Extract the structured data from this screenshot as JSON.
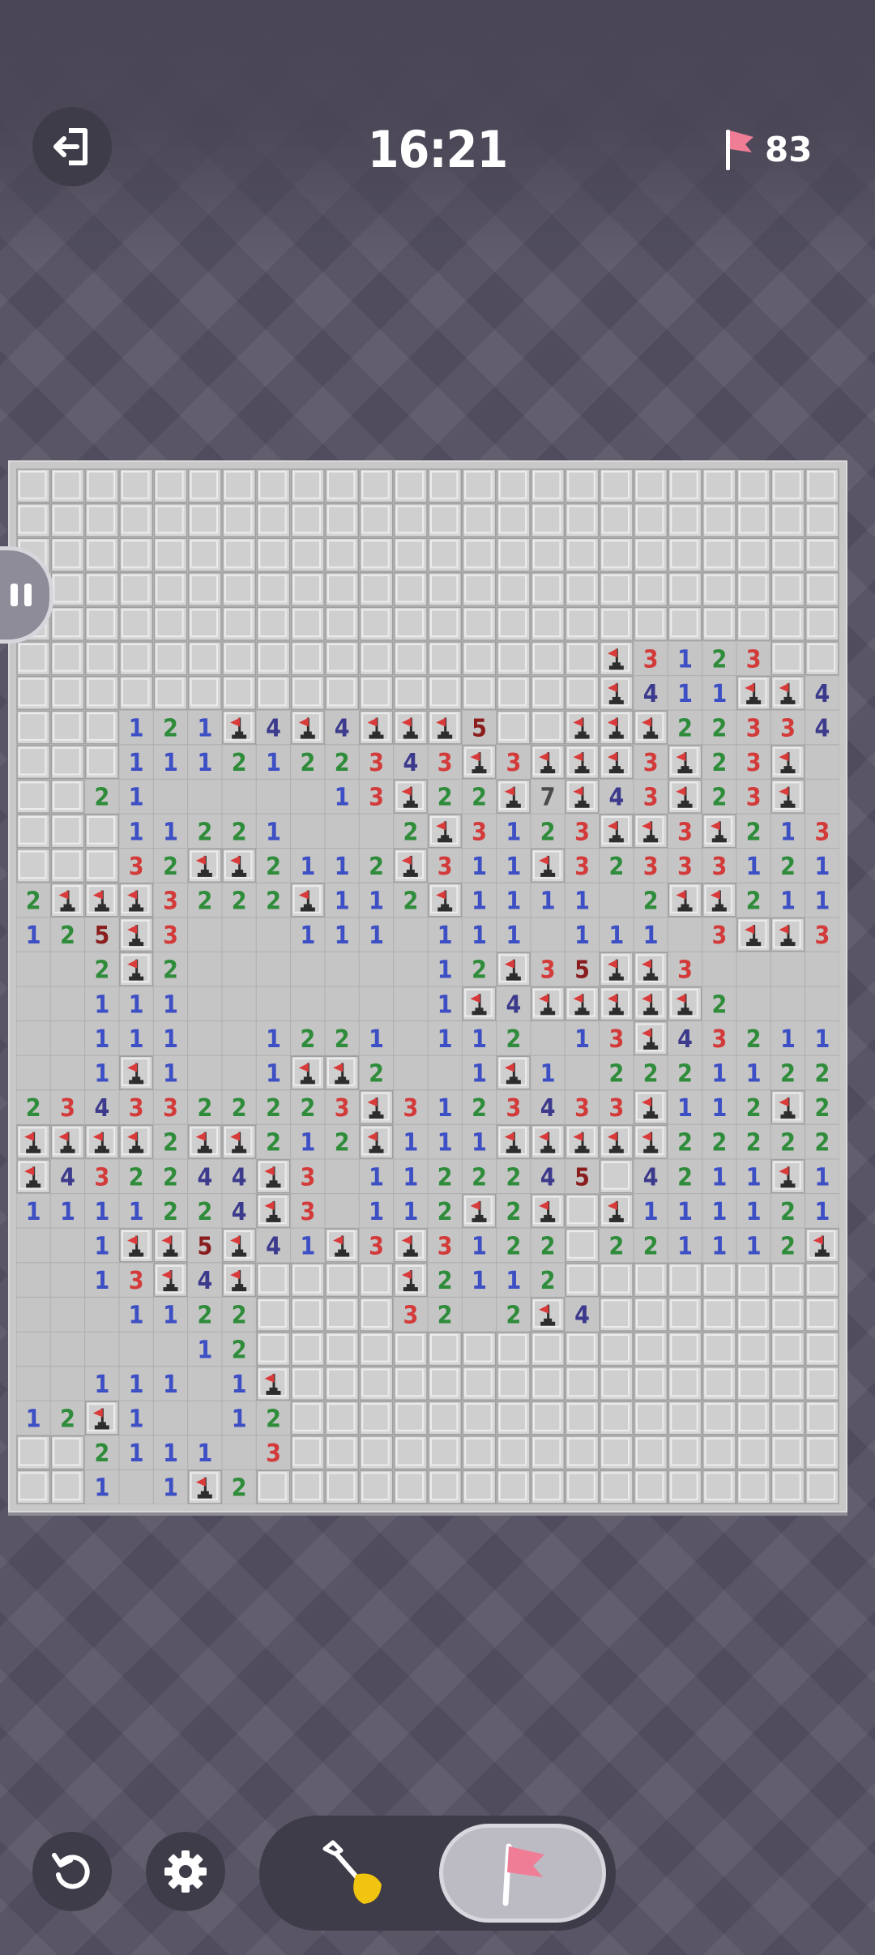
{
  "header": {
    "exit_icon": "exit-icon",
    "time": "16:21",
    "flag_icon": "flag-icon",
    "flags_remaining": "83"
  },
  "board": {
    "columns": 24,
    "rows": 30,
    "legend": "# = unrevealed, F = flagged, . = empty revealed, 1-8 = mine count",
    "grid": [
      "########################",
      "########################",
      "########################",
      "########################",
      "########################",
      "#################F3123##",
      "#################F411FF4F",
      "###121F4F4FFF5##FFF22334F",
      "###1112122343F3FFF3F23F",
      "##21.....13F22F7F43F23F",
      "###11221...2F3123FF3F213F",
      "###32FF2112F311F32333121F",
      "2FFF3222F112F1111.2FF211",
      "125F3...111.111.111.3FF3..",
      "..2F2.......12F35FF3..",
      "..111.......1F4FFFFF2..",
      "..111..1221.112.13F4321111",
      "..1F1..1FF2..1F1.22211221F",
      "2343322223F3123433F112F2F3",
      "FFFF2FF212F111FFFFF2222222F",
      "F432244F3.1122245#4211F1.22",
      "1111224F3.112F2F#F1111212F",
      "..1FF5F41F3F3122#221112F42",
      "..13F4F####F2112##########",
      "...1122####32 2F4##########",
      ".....12#################",
      "..111.1F################",
      "12F1..12################",
      "##2111 3################",
      "##1.1F2#################"
    ],
    "colors": {
      "1": "#3d4fc4",
      "2": "#2e8c3a",
      "3": "#d33a3a",
      "4": "#3c3a8c",
      "5": "#8a1d1d",
      "7": "#4a4a4a"
    }
  },
  "controls": {
    "restart_icon": "restart-icon",
    "settings_icon": "gear-icon",
    "dig_icon": "shovel-icon",
    "flag_mode_icon": "flag-icon",
    "active_mode": "flag"
  }
}
